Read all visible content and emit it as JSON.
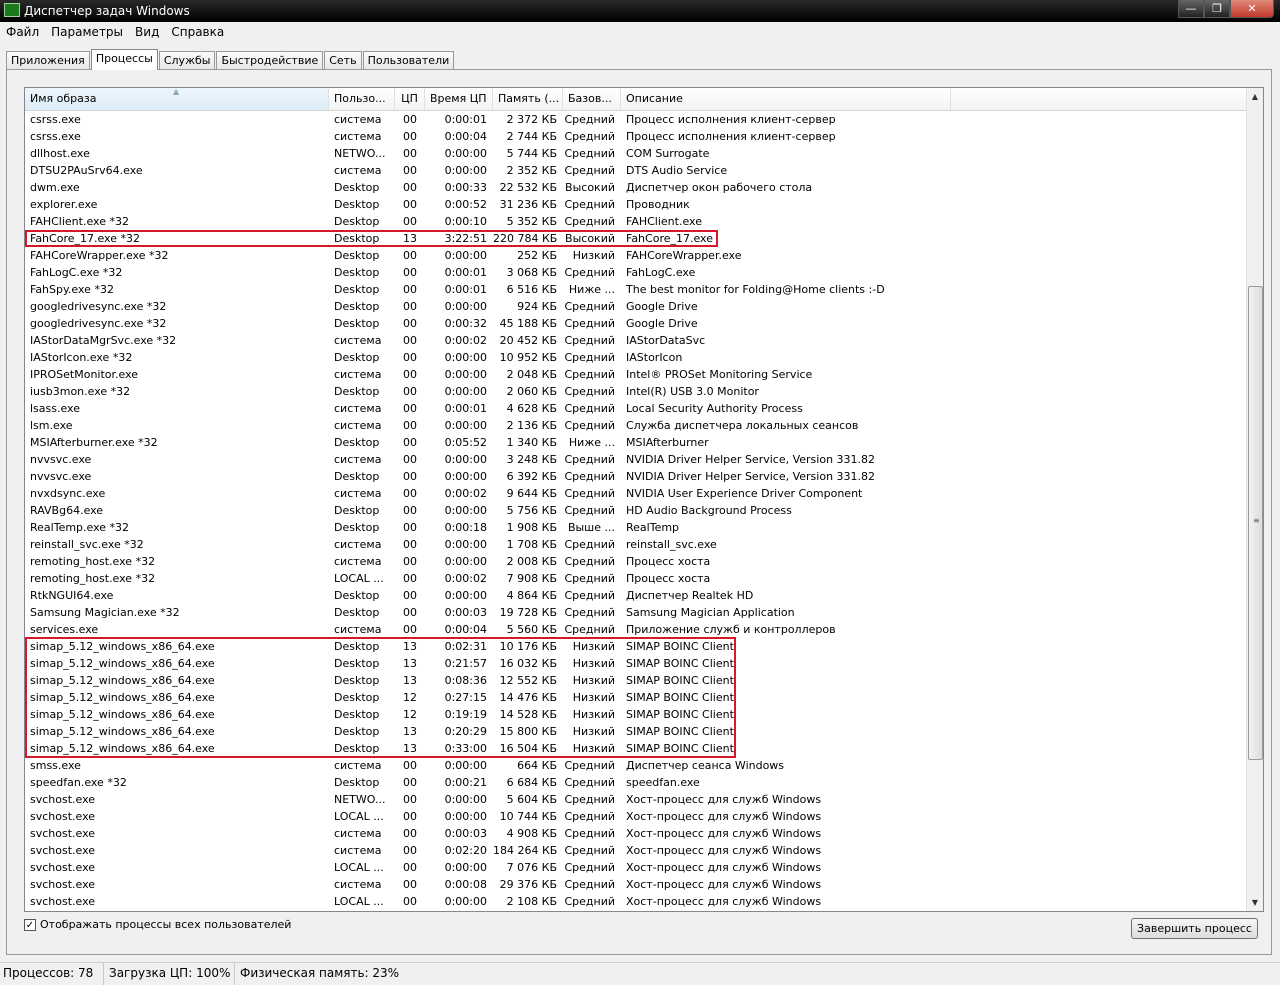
{
  "window": {
    "title": "Диспетчер задач Windows",
    "min_glyph": "—",
    "max_glyph": "❐",
    "close_glyph": "✕"
  },
  "menu": [
    "Файл",
    "Параметры",
    "Вид",
    "Справка"
  ],
  "tabs": [
    "Приложения",
    "Процессы",
    "Службы",
    "Быстродействие",
    "Сеть",
    "Пользователи"
  ],
  "active_tab": 1,
  "columns": [
    "Имя образа",
    "Пользо...",
    "ЦП",
    "Время ЦП",
    "Память (...",
    "Базов...",
    "Описание",
    ""
  ],
  "sort_glyph": "▲",
  "rows": [
    [
      "csrss.exe",
      "система",
      "00",
      "0:00:01",
      "2 372 КБ",
      "Средний",
      "Процесс исполнения клиент-сервер"
    ],
    [
      "csrss.exe",
      "система",
      "00",
      "0:00:04",
      "2 744 КБ",
      "Средний",
      "Процесс исполнения клиент-сервер"
    ],
    [
      "dllhost.exe",
      "NETWO...",
      "00",
      "0:00:00",
      "5 744 КБ",
      "Средний",
      "COM Surrogate"
    ],
    [
      "DTSU2PAuSrv64.exe",
      "система",
      "00",
      "0:00:00",
      "2 352 КБ",
      "Средний",
      "DTS Audio Service"
    ],
    [
      "dwm.exe",
      "Desktop",
      "00",
      "0:00:33",
      "22 532 КБ",
      "Высокий",
      "Диспетчер окон рабочего стола"
    ],
    [
      "explorer.exe",
      "Desktop",
      "00",
      "0:00:52",
      "31 236 КБ",
      "Средний",
      "Проводник"
    ],
    [
      "FAHClient.exe *32",
      "Desktop",
      "00",
      "0:00:10",
      "5 352 КБ",
      "Средний",
      "FAHClient.exe"
    ],
    [
      "FahCore_17.exe *32",
      "Desktop",
      "13",
      "3:22:51",
      "220 784 КБ",
      "Высокий",
      "FahCore_17.exe"
    ],
    [
      "FAHCoreWrapper.exe *32",
      "Desktop",
      "00",
      "0:00:00",
      "252 КБ",
      "Низкий",
      "FAHCoreWrapper.exe"
    ],
    [
      "FahLogC.exe *32",
      "Desktop",
      "00",
      "0:00:01",
      "3 068 КБ",
      "Средний",
      "FahLogC.exe"
    ],
    [
      "FahSpy.exe *32",
      "Desktop",
      "00",
      "0:00:01",
      "6 516 КБ",
      "Ниже ...",
      "The best monitor for Folding@Home clients :-D"
    ],
    [
      "googledrivesync.exe *32",
      "Desktop",
      "00",
      "0:00:00",
      "924 КБ",
      "Средний",
      "Google Drive"
    ],
    [
      "googledrivesync.exe *32",
      "Desktop",
      "00",
      "0:00:32",
      "45 188 КБ",
      "Средний",
      "Google Drive"
    ],
    [
      "IAStorDataMgrSvc.exe *32",
      "система",
      "00",
      "0:00:02",
      "20 452 КБ",
      "Средний",
      "IAStorDataSvc"
    ],
    [
      "IAStorIcon.exe *32",
      "Desktop",
      "00",
      "0:00:00",
      "10 952 КБ",
      "Средний",
      "IAStorIcon"
    ],
    [
      "IPROSetMonitor.exe",
      "система",
      "00",
      "0:00:00",
      "2 048 КБ",
      "Средний",
      "Intel® PROSet Monitoring Service"
    ],
    [
      "iusb3mon.exe *32",
      "Desktop",
      "00",
      "0:00:00",
      "2 060 КБ",
      "Средний",
      "Intel(R) USB 3.0 Monitor"
    ],
    [
      "lsass.exe",
      "система",
      "00",
      "0:00:01",
      "4 628 КБ",
      "Средний",
      "Local Security Authority Process"
    ],
    [
      "lsm.exe",
      "система",
      "00",
      "0:00:00",
      "2 136 КБ",
      "Средний",
      "Служба диспетчера локальных сеансов"
    ],
    [
      "MSIAfterburner.exe *32",
      "Desktop",
      "00",
      "0:05:52",
      "1 340 КБ",
      "Ниже ...",
      "MSIAfterburner"
    ],
    [
      "nvvsvc.exe",
      "система",
      "00",
      "0:00:00",
      "3 248 КБ",
      "Средний",
      "NVIDIA Driver Helper Service, Version 331.82"
    ],
    [
      "nvvsvc.exe",
      "Desktop",
      "00",
      "0:00:00",
      "6 392 КБ",
      "Средний",
      "NVIDIA Driver Helper Service, Version 331.82"
    ],
    [
      "nvxdsync.exe",
      "система",
      "00",
      "0:00:02",
      "9 644 КБ",
      "Средний",
      "NVIDIA User Experience Driver Component"
    ],
    [
      "RAVBg64.exe",
      "Desktop",
      "00",
      "0:00:00",
      "5 756 КБ",
      "Средний",
      "HD Audio Background Process"
    ],
    [
      "RealTemp.exe *32",
      "Desktop",
      "00",
      "0:00:18",
      "1 908 КБ",
      "Выше ...",
      "RealTemp"
    ],
    [
      "reinstall_svc.exe *32",
      "система",
      "00",
      "0:00:00",
      "1 708 КБ",
      "Средний",
      "reinstall_svc.exe"
    ],
    [
      "remoting_host.exe *32",
      "система",
      "00",
      "0:00:00",
      "2 008 КБ",
      "Средний",
      "Процесс хоста"
    ],
    [
      "remoting_host.exe *32",
      "LOCAL ...",
      "00",
      "0:00:02",
      "7 908 КБ",
      "Средний",
      "Процесс хоста"
    ],
    [
      "RtkNGUI64.exe",
      "Desktop",
      "00",
      "0:00:00",
      "4 864 КБ",
      "Средний",
      "Диспетчер Realtek HD"
    ],
    [
      "Samsung Magician.exe *32",
      "Desktop",
      "00",
      "0:00:03",
      "19 728 КБ",
      "Средний",
      "Samsung Magician Application"
    ],
    [
      "services.exe",
      "система",
      "00",
      "0:00:04",
      "5 560 КБ",
      "Средний",
      "Приложение служб и контроллеров"
    ],
    [
      "simap_5.12_windows_x86_64.exe",
      "Desktop",
      "13",
      "0:02:31",
      "10 176 КБ",
      "Низкий",
      "SIMAP BOINC Client"
    ],
    [
      "simap_5.12_windows_x86_64.exe",
      "Desktop",
      "13",
      "0:21:57",
      "16 032 КБ",
      "Низкий",
      "SIMAP BOINC Client"
    ],
    [
      "simap_5.12_windows_x86_64.exe",
      "Desktop",
      "13",
      "0:08:36",
      "12 552 КБ",
      "Низкий",
      "SIMAP BOINC Client"
    ],
    [
      "simap_5.12_windows_x86_64.exe",
      "Desktop",
      "12",
      "0:27:15",
      "14 476 КБ",
      "Низкий",
      "SIMAP BOINC Client"
    ],
    [
      "simap_5.12_windows_x86_64.exe",
      "Desktop",
      "12",
      "0:19:19",
      "14 528 КБ",
      "Низкий",
      "SIMAP BOINC Client"
    ],
    [
      "simap_5.12_windows_x86_64.exe",
      "Desktop",
      "13",
      "0:20:29",
      "15 800 КБ",
      "Низкий",
      "SIMAP BOINC Client"
    ],
    [
      "simap_5.12_windows_x86_64.exe",
      "Desktop",
      "13",
      "0:33:00",
      "16 504 КБ",
      "Низкий",
      "SIMAP BOINC Client"
    ],
    [
      "smss.exe",
      "система",
      "00",
      "0:00:00",
      "664 КБ",
      "Средний",
      "Диспетчер сеанса  Windows"
    ],
    [
      "speedfan.exe *32",
      "Desktop",
      "00",
      "0:00:21",
      "6 684 КБ",
      "Средний",
      "speedfan.exe"
    ],
    [
      "svchost.exe",
      "NETWO...",
      "00",
      "0:00:00",
      "5 604 КБ",
      "Средний",
      "Хост-процесс для служб Windows"
    ],
    [
      "svchost.exe",
      "LOCAL ...",
      "00",
      "0:00:00",
      "10 744 КБ",
      "Средний",
      "Хост-процесс для служб Windows"
    ],
    [
      "svchost.exe",
      "система",
      "00",
      "0:00:03",
      "4 908 КБ",
      "Средний",
      "Хост-процесс для служб Windows"
    ],
    [
      "svchost.exe",
      "система",
      "00",
      "0:02:20",
      "184 264 КБ",
      "Средний",
      "Хост-процесс для служб Windows"
    ],
    [
      "svchost.exe",
      "LOCAL ...",
      "00",
      "0:00:00",
      "7 076 КБ",
      "Средний",
      "Хост-процесс для служб Windows"
    ],
    [
      "svchost.exe",
      "система",
      "00",
      "0:00:08",
      "29 376 КБ",
      "Средний",
      "Хост-процесс для служб Windows"
    ],
    [
      "svchost.exe",
      "LOCAL ...",
      "00",
      "0:00:00",
      "2 108 КБ",
      "Средний",
      "Хост-процесс для служб Windows"
    ]
  ],
  "highlight_colour": "#d7182a",
  "scrollbar": {
    "up_glyph": "▲",
    "down_glyph": "▼",
    "grip_glyph": "≡"
  },
  "show_all_users": {
    "label": "Отображать процессы всех пользователей",
    "checked_glyph": "✓"
  },
  "end_process_label": "Завершить процесс",
  "status": {
    "processes": "Процессов: 78",
    "cpu": "Загрузка ЦП: 100%",
    "memory": "Физическая память: 23%"
  }
}
